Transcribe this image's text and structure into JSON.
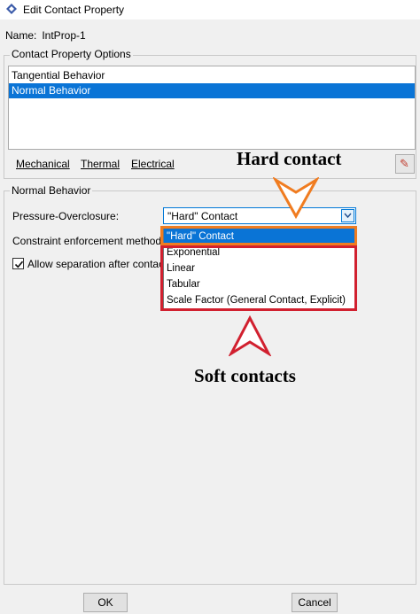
{
  "window": {
    "title": "Edit Contact Property"
  },
  "name": {
    "label": "Name:",
    "value": "IntProp-1"
  },
  "options": {
    "group_title": "Contact Property Options",
    "items": [
      "Tangential Behavior",
      "Normal Behavior"
    ],
    "selected": "Normal Behavior"
  },
  "menu": {
    "mechanical": "Mechanical",
    "thermal": "Thermal",
    "electrical": "Electrical"
  },
  "normal": {
    "group_title": "Normal Behavior",
    "pressure_label": "Pressure-Overclosure:",
    "pressure_value": "\"Hard\" Contact",
    "constraint_label": "Constraint enforcement method:",
    "allow_label": "Allow separation after contact",
    "allow_checked": true
  },
  "dropdown": {
    "options": [
      "\"Hard\" Contact",
      "Exponential",
      "Linear",
      "Tabular",
      "Scale Factor (General Contact, Explicit)"
    ],
    "highlighted": "\"Hard\" Contact"
  },
  "annotations": {
    "hard": "Hard contact",
    "soft": "Soft contacts",
    "hard_color": "#f07c20",
    "soft_color": "#d1202f"
  },
  "buttons": {
    "ok": "OK",
    "cancel": "Cancel"
  },
  "colors": {
    "selection": "#0a74d6",
    "focus_border": "#0078d7"
  }
}
